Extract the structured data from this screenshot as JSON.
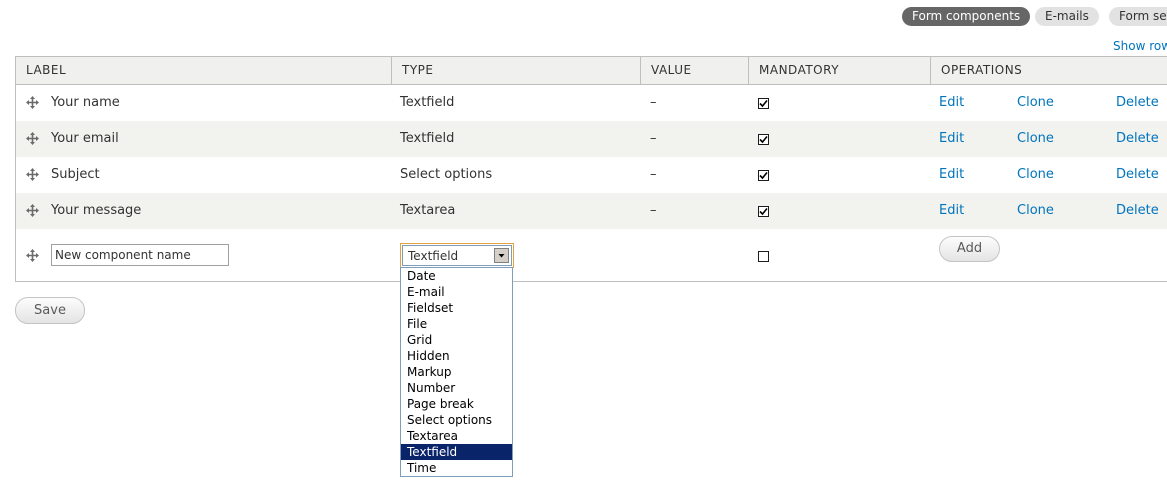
{
  "tabs": [
    {
      "label": "Form components",
      "active": true
    },
    {
      "label": "E-mails",
      "active": false
    },
    {
      "label": "Form set",
      "active": false
    }
  ],
  "show_row_link": "Show row",
  "table": {
    "columns": [
      "LABEL",
      "TYPE",
      "VALUE",
      "MANDATORY",
      "OPERATIONS"
    ],
    "rows": [
      {
        "label": "Your name",
        "type": "Textfield",
        "value": "–",
        "mandatory": true,
        "ops": [
          "Edit",
          "Clone",
          "Delete"
        ]
      },
      {
        "label": "Your email",
        "type": "Textfield",
        "value": "–",
        "mandatory": true,
        "ops": [
          "Edit",
          "Clone",
          "Delete"
        ]
      },
      {
        "label": "Subject",
        "type": "Select options",
        "value": "–",
        "mandatory": true,
        "ops": [
          "Edit",
          "Clone",
          "Delete"
        ]
      },
      {
        "label": "Your message",
        "type": "Textarea",
        "value": "–",
        "mandatory": true,
        "ops": [
          "Edit",
          "Clone",
          "Delete"
        ]
      }
    ],
    "new_row": {
      "name_placeholder": "New component name",
      "type_selected": "Textfield",
      "mandatory": false,
      "add_label": "Add"
    }
  },
  "save_label": "Save",
  "type_options": [
    "Date",
    "E-mail",
    "Fieldset",
    "File",
    "Grid",
    "Hidden",
    "Markup",
    "Number",
    "Page break",
    "Select options",
    "Textarea",
    "Textfield",
    "Time"
  ],
  "type_options_selected": "Textfield",
  "colors": {
    "link": "#0074bd",
    "active_tab": "#666666",
    "selected_option": "#0a246a",
    "focus_border": "#e3a23b"
  }
}
